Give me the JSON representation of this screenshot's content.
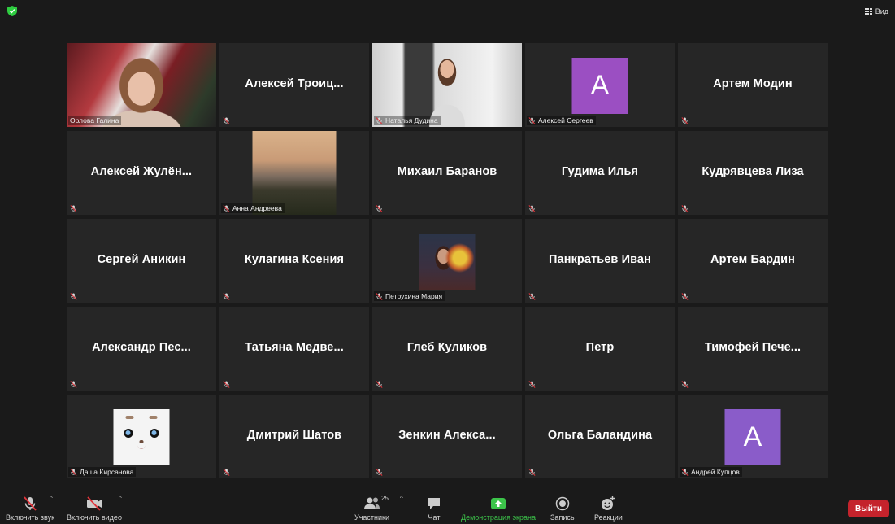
{
  "top": {
    "view_label": "Вид",
    "security_color": "#2ecc40"
  },
  "tiles": [
    {
      "display": "video",
      "photo": "orlova",
      "nameplate": "Орлова Галина",
      "active": true,
      "muted": false
    },
    {
      "display": "name",
      "big": "Алексей  Троиц...",
      "muted": true
    },
    {
      "display": "video",
      "photo": "natalya",
      "nameplate": "Наталья Дудина",
      "muted": true
    },
    {
      "display": "avatar",
      "letter": "A",
      "nameplate": "Алексей Сергеев",
      "muted": true,
      "avatar_color": "#9b4fc2"
    },
    {
      "display": "name",
      "big": "Артем Модин",
      "muted": true
    },
    {
      "display": "name",
      "big": "Алексей  Жулён...",
      "muted": true
    },
    {
      "display": "photo",
      "photo": "anna",
      "nameplate": "Анна Андреева",
      "muted": true
    },
    {
      "display": "name",
      "big": "Михаил Баранов",
      "muted": true
    },
    {
      "display": "name",
      "big": "Гудима Илья",
      "muted": true
    },
    {
      "display": "name",
      "big": "Кудрявцева Лиза",
      "muted": true
    },
    {
      "display": "name",
      "big": "Сергей Аникин",
      "muted": true
    },
    {
      "display": "name",
      "big": "Кулагина Ксения",
      "muted": true
    },
    {
      "display": "photo",
      "photo": "petr",
      "nameplate": "Петрухина Мария",
      "muted": true
    },
    {
      "display": "name",
      "big": "Панкратьев Иван",
      "muted": true
    },
    {
      "display": "name",
      "big": "Артем Бардин",
      "muted": true
    },
    {
      "display": "name",
      "big": "Александр  Пес...",
      "muted": true
    },
    {
      "display": "name",
      "big": "Татьяна  Медве...",
      "muted": true
    },
    {
      "display": "name",
      "big": "Глеб Куликов",
      "muted": true
    },
    {
      "display": "name",
      "big": "Петр",
      "muted": true
    },
    {
      "display": "name",
      "big": "Тимофей  Пече...",
      "muted": true
    },
    {
      "display": "photo",
      "photo": "dasha",
      "nameplate": "Даша Кирсанова",
      "muted": true
    },
    {
      "display": "name",
      "big": "Дмитрий Шатов",
      "muted": true
    },
    {
      "display": "name",
      "big": "Зенкин  Алекса...",
      "muted": true
    },
    {
      "display": "name",
      "big": "Ольга Баландина",
      "muted": true
    },
    {
      "display": "avatar",
      "letter": "A",
      "nameplate": "Андрей Купцов",
      "muted": true,
      "avatar_color": "#8a5cc9"
    }
  ],
  "toolbar": {
    "audio_label": "Включить звук",
    "video_label": "Включить видео",
    "participants_label": "Участники",
    "participants_count": "25",
    "chat_label": "Чат",
    "share_label": "Демонстрация экрана",
    "record_label": "Запись",
    "reactions_label": "Реакции",
    "leave_label": "Выйти",
    "share_color": "#3cc44a",
    "leave_color": "#c4232c"
  }
}
